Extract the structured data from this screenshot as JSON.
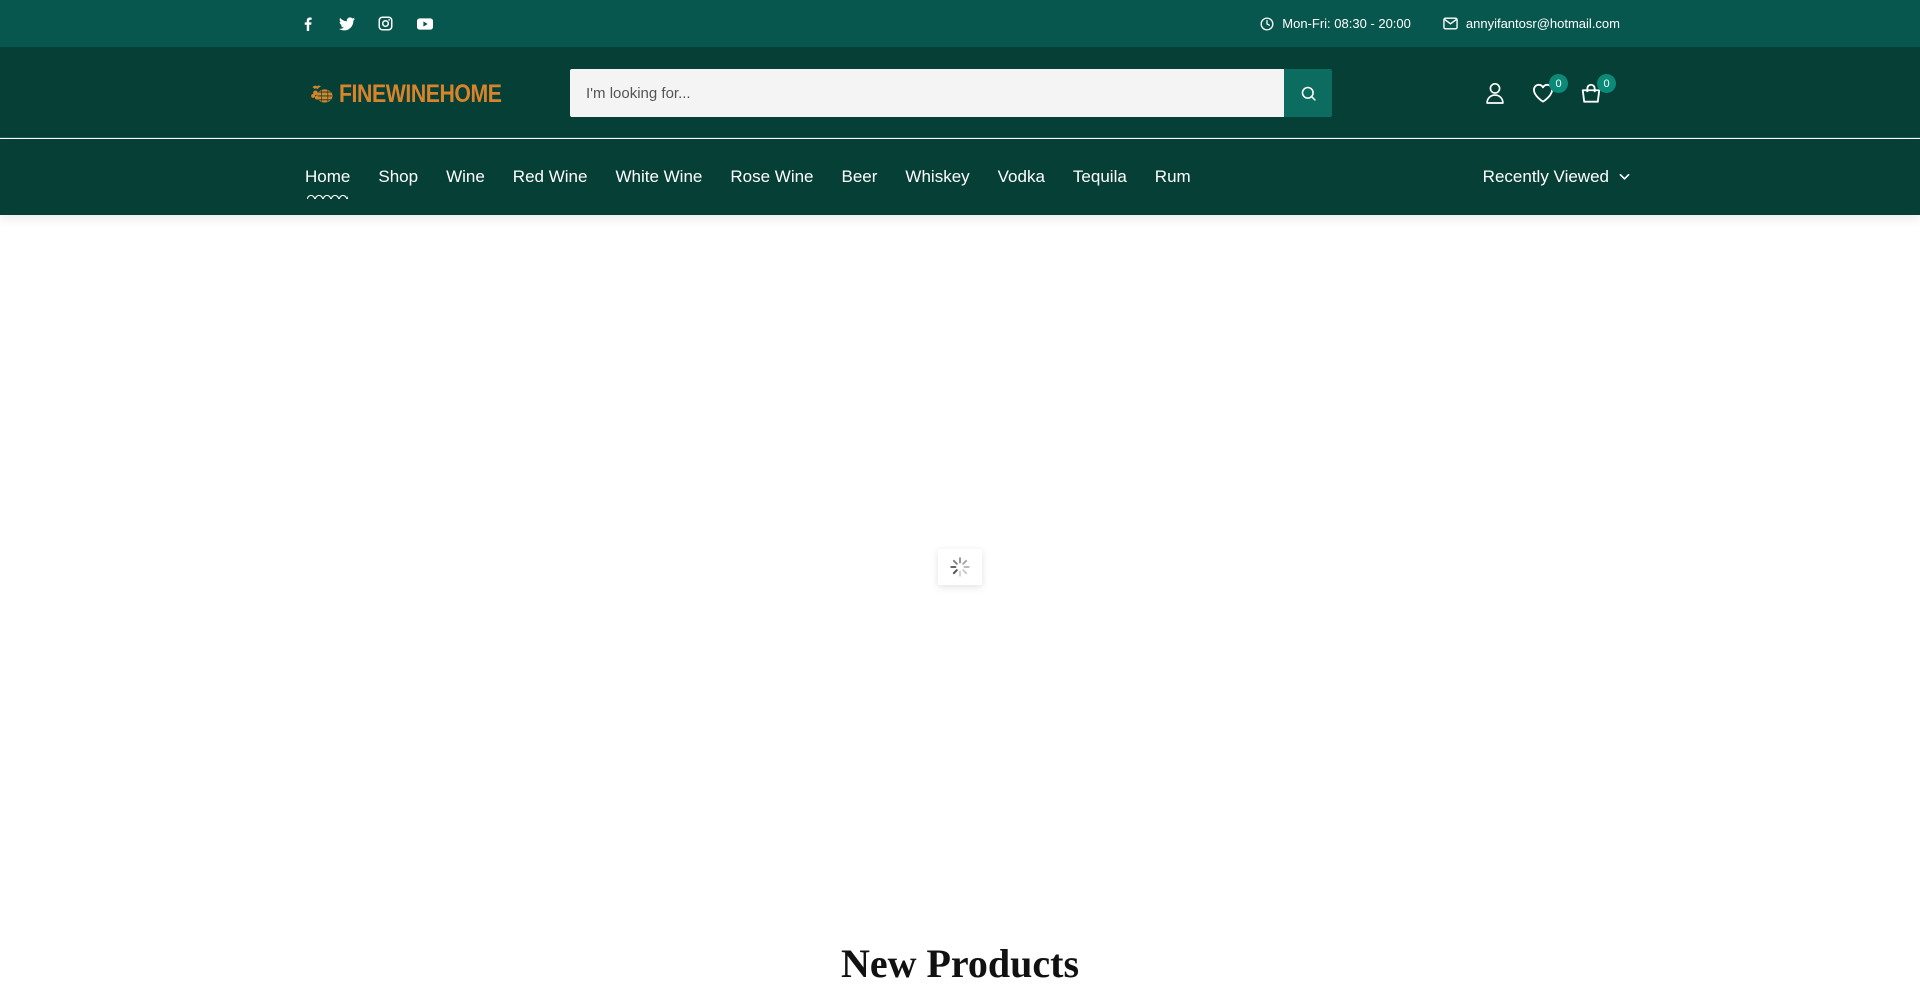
{
  "topbar": {
    "social": [
      "facebook-icon",
      "twitter-icon",
      "instagram-icon",
      "youtube-icon"
    ],
    "hours": "Mon-Fri: 08:30 - 20:00",
    "email": "annyifantosr@hotmail.com"
  },
  "header": {
    "logo_text": "FINEWINEHOME",
    "search_placeholder": "I'm looking for...",
    "wishlist_count": "0",
    "cart_count": "0"
  },
  "nav": {
    "items": [
      "Home",
      "Shop",
      "Wine",
      "Red Wine",
      "White Wine",
      "Rose Wine",
      "Beer",
      "Whiskey",
      "Vodka",
      "Tequila",
      "Rum"
    ],
    "active": "Home",
    "recently_viewed": "Recently Viewed"
  },
  "main": {
    "section_title": "New Products"
  },
  "colors": {
    "topbar": "#07574e",
    "header": "#053f36",
    "accent": "#0b6c5f",
    "logo": "#d8842a"
  }
}
